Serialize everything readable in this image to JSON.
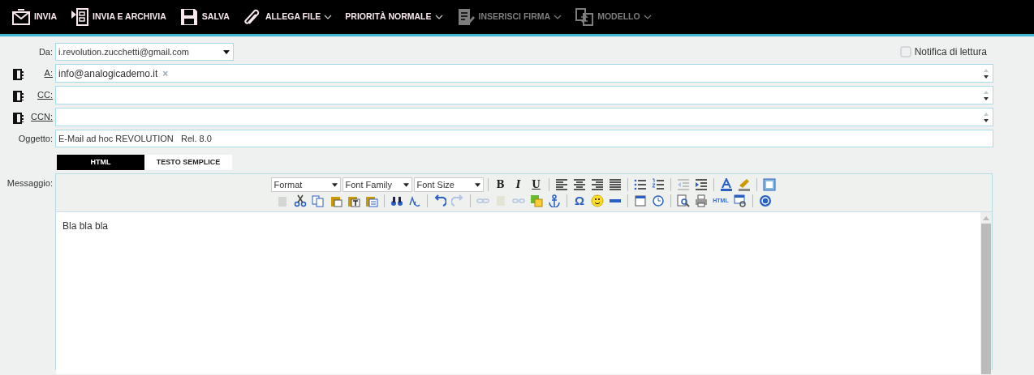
{
  "toolbar": [
    {
      "label": "INVIA",
      "dropdown": false,
      "disabled": false
    },
    {
      "label": "INVIA E ARCHIVIA",
      "dropdown": false,
      "disabled": false
    },
    {
      "label": "SALVA",
      "dropdown": false,
      "disabled": false
    },
    {
      "label": "ALLEGA FILE",
      "dropdown": true,
      "disabled": false
    },
    {
      "label": "PRIORITÀ NORMALE",
      "dropdown": true,
      "disabled": false
    },
    {
      "label": "INSERISCI FIRMA",
      "dropdown": true,
      "disabled": true
    },
    {
      "label": "MODELLO",
      "dropdown": true,
      "disabled": true
    }
  ],
  "from": {
    "label": "Da:",
    "value": "i.revolution.zucchetti@gmail.com"
  },
  "read_receipt": {
    "label": "Notifica di lettura",
    "checked": false
  },
  "recipients": [
    {
      "label": "A:",
      "chips": [
        {
          "text": "info@analogicademo.it",
          "remove": "×"
        }
      ]
    },
    {
      "label": "CC:"
    },
    {
      "label": "CCN:"
    }
  ],
  "subject": {
    "label": "Oggetto:",
    "value": "E-Mail ad hoc REVOLUTION   Rel. 8.0"
  },
  "format_tabs": [
    {
      "label": "HTML",
      "selected": true
    },
    {
      "label": "TESTO SEMPLICE",
      "selected": false
    }
  ],
  "message": {
    "label": "Messaggio:",
    "body": "Bla bla bla",
    "toolbar_rows": [
      [
        {
          "kind": "select",
          "label": "Format"
        },
        {
          "kind": "select",
          "label": "Font Family"
        },
        {
          "kind": "select",
          "label": "Font Size"
        },
        {
          "kind": "sep"
        },
        {
          "kind": "glyph",
          "text": "B",
          "disabled": false
        },
        {
          "kind": "glyph",
          "text": "I",
          "disabled": false
        },
        {
          "kind": "glyph",
          "text": "U",
          "disabled": false
        },
        {
          "kind": "sep"
        },
        {
          "kind": "icon",
          "disabled": false
        },
        {
          "kind": "icon",
          "disabled": false
        },
        {
          "kind": "icon",
          "disabled": false
        },
        {
          "kind": "icon",
          "disabled": false
        },
        {
          "kind": "sep"
        },
        {
          "kind": "icon",
          "disabled": false
        },
        {
          "kind": "icon",
          "disabled": false
        },
        {
          "kind": "sep"
        },
        {
          "kind": "icon",
          "disabled": true
        },
        {
          "kind": "icon",
          "disabled": false
        },
        {
          "kind": "sep"
        },
        {
          "kind": "icon",
          "disabled": false
        },
        {
          "kind": "icon",
          "disabled": false
        },
        {
          "kind": "sep"
        },
        {
          "kind": "icon",
          "disabled": false
        }
      ],
      [
        {
          "kind": "icon",
          "disabled": true
        },
        {
          "kind": "icon",
          "disabled": false
        },
        {
          "kind": "icon",
          "disabled": false
        },
        {
          "kind": "icon",
          "disabled": false
        },
        {
          "kind": "icon",
          "disabled": false
        },
        {
          "kind": "icon",
          "disabled": false
        },
        {
          "kind": "sep"
        },
        {
          "kind": "icon",
          "disabled": false
        },
        {
          "kind": "icon",
          "disabled": false
        },
        {
          "kind": "sep"
        },
        {
          "kind": "icon",
          "disabled": false
        },
        {
          "kind": "icon",
          "disabled": true
        },
        {
          "kind": "sep"
        },
        {
          "kind": "icon",
          "disabled": true
        },
        {
          "kind": "icon",
          "disabled": true
        },
        {
          "kind": "icon",
          "disabled": true
        },
        {
          "kind": "icon",
          "disabled": false
        },
        {
          "kind": "icon",
          "disabled": false
        },
        {
          "kind": "sep"
        },
        {
          "kind": "glyph",
          "text": "Ω",
          "disabled": false
        },
        {
          "kind": "icon",
          "disabled": false
        },
        {
          "kind": "icon",
          "disabled": false
        },
        {
          "kind": "sep"
        },
        {
          "kind": "icon",
          "disabled": false
        },
        {
          "kind": "icon",
          "disabled": false
        },
        {
          "kind": "sep"
        },
        {
          "kind": "icon",
          "disabled": false
        },
        {
          "kind": "icon",
          "disabled": false
        },
        {
          "kind": "glyph",
          "text": "HTML",
          "disabled": false
        },
        {
          "kind": "icon",
          "disabled": false
        },
        {
          "kind": "sep"
        },
        {
          "kind": "icon",
          "disabled": false
        }
      ]
    ]
  }
}
